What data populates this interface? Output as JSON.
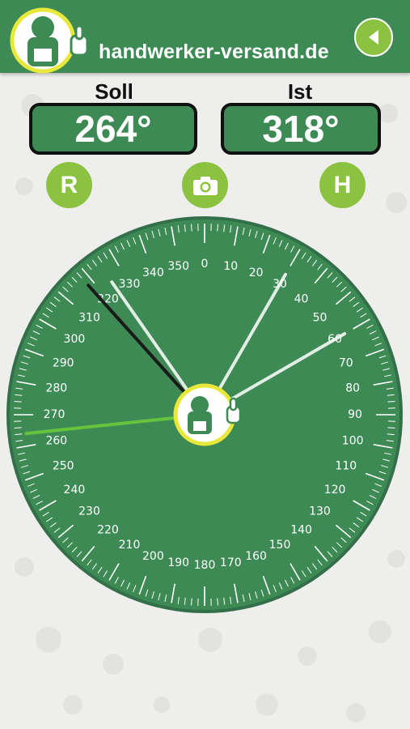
{
  "header": {
    "site_name": "handwerker-versand.de",
    "back_icon": "back-arrow-icon",
    "logo_icon": "mascot-thumbs-up-logo"
  },
  "soll": {
    "label": "Soll",
    "value": "264°"
  },
  "ist": {
    "label": "Ist",
    "value": "318°"
  },
  "buttons": {
    "r": "R",
    "camera_icon": "camera-icon",
    "h": "H"
  },
  "compass": {
    "labels": [
      "0",
      "10",
      "20",
      "30",
      "40",
      "50",
      "60",
      "70",
      "80",
      "90",
      "100",
      "110",
      "120",
      "130",
      "140",
      "150",
      "160",
      "170",
      "180",
      "190",
      "200",
      "210",
      "220",
      "230",
      "240",
      "250",
      "260",
      "270",
      "280",
      "290",
      "300",
      "310",
      "320",
      "330",
      "340",
      "350"
    ],
    "needles": {
      "light_green_deg": 264,
      "dark_deg": 318,
      "white_degs": [
        325,
        30,
        60
      ]
    }
  },
  "colors": {
    "header": "#3d8a55",
    "dial": "#3d8a55",
    "accent": "#8bc340",
    "logo_ring": "#e8e83a"
  }
}
